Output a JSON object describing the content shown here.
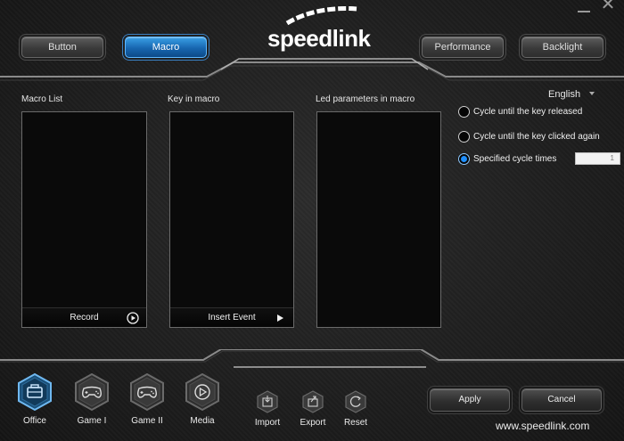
{
  "brand": {
    "logo_text": "speedlink",
    "website": "www.speedlink.com"
  },
  "nav": {
    "tabs": [
      {
        "label": "Button",
        "active": false
      },
      {
        "label": "Macro",
        "active": true
      },
      {
        "label": "Performance",
        "active": false
      },
      {
        "label": "Backlight",
        "active": false
      }
    ]
  },
  "sections": {
    "macro_list": {
      "label": "Macro List",
      "footer_label": "Record",
      "footer_icon": "record-play-icon"
    },
    "key_in_macro": {
      "label": "Key in macro",
      "footer_label": "Insert Event",
      "footer_icon": "play-triangle-icon"
    },
    "led_parameters": {
      "label": "Led parameters in macro"
    }
  },
  "language": {
    "selected": "English"
  },
  "cycle_options": [
    {
      "label": "Cycle until the key released",
      "checked": false
    },
    {
      "label": "Cycle until the key clicked again",
      "checked": false
    },
    {
      "label": "Specified cycle times",
      "checked": true
    }
  ],
  "cycle_count": "1",
  "profiles": [
    {
      "label": "Office",
      "icon": "briefcase-icon",
      "active": true
    },
    {
      "label": "Game I",
      "icon": "gamepad-icon",
      "active": false
    },
    {
      "label": "Game II",
      "icon": "gamepad-icon",
      "active": false
    },
    {
      "label": "Media",
      "icon": "play-circle-icon",
      "active": false
    }
  ],
  "actions": [
    {
      "label": "Import",
      "icon": "import-icon"
    },
    {
      "label": "Export",
      "icon": "export-icon"
    },
    {
      "label": "Reset",
      "icon": "reset-icon"
    }
  ],
  "footer_buttons": {
    "apply": "Apply",
    "cancel": "Cancel"
  },
  "colors": {
    "accent": "#1e8fff",
    "active_tab": "#1766b0",
    "background": "#1e1e1e",
    "list_bg": "#0a0a0a"
  }
}
